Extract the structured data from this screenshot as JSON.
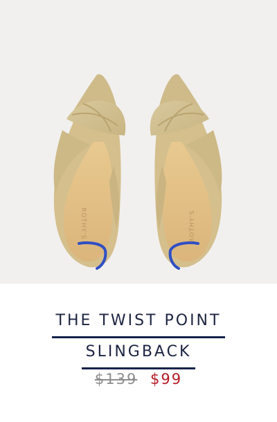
{
  "product": {
    "title_line1": "THE TWIST POINT",
    "title_line2": "SLINGBACK",
    "price_original": "$139",
    "price_sale": "$99",
    "image_name": "product-image"
  },
  "colors": {
    "background": "#f1f0ee",
    "title": "#1c2340",
    "underline": "#15224a",
    "original_price": "#8c8c8c",
    "sale_price": "#b21a24",
    "shoe_suede": "#d2c193",
    "shoe_insole": "#e2c08a",
    "heel_strip": "#2f4fc4"
  }
}
